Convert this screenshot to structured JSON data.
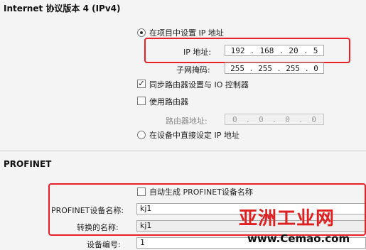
{
  "ipv4": {
    "title": "Internet 协议版本 4 (IPv4)",
    "radio_project_label": "在项目中设置 IP 地址",
    "ip_label": "IP 地址:",
    "ip": [
      "192",
      "168",
      "20",
      "5"
    ],
    "subnet_label": "子网掩码:",
    "subnet": [
      "255",
      "255",
      "255",
      "0"
    ],
    "sync_router_label": "同步路由器设置与 IO 控制器",
    "use_router_label": "使用路由器",
    "router_label": "路由器地址:",
    "router": [
      "0",
      "0",
      "0",
      "0"
    ],
    "radio_device_label": "在设备中直接设定 IP 地址"
  },
  "profinet": {
    "title": "PROFINET",
    "auto_generate_label": "自动生成 PROFINET设备名称",
    "device_name_label": "PROFINET设备名称:",
    "device_name_value": "kj1",
    "converted_name_label": "转换的名称:",
    "converted_name_value": "kj1",
    "device_number_label": "设备编号:",
    "device_number_value": "1"
  },
  "watermark": {
    "text_cn": "亚洲工业网",
    "url": "www.Cemao.com"
  },
  "colors": {
    "highlight": "#e8202a",
    "background": "#f4f4f4"
  }
}
